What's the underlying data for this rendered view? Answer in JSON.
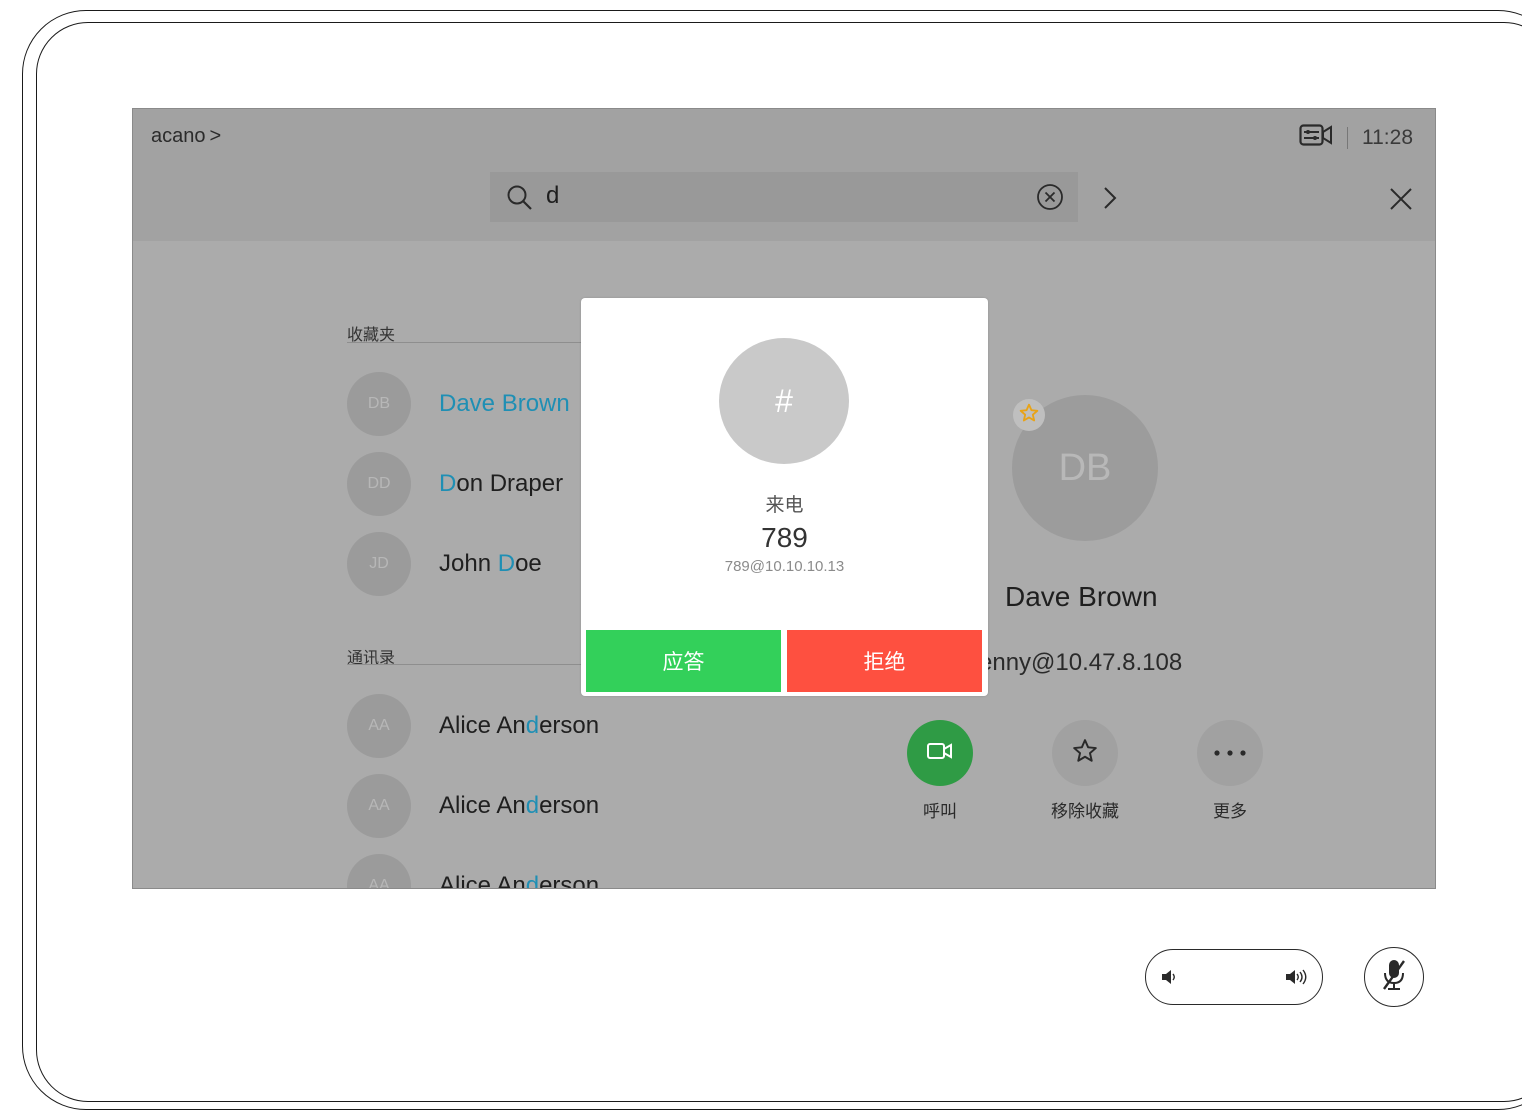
{
  "header": {
    "breadcrumb": "acano",
    "breadcrumb_chevron": ">",
    "time": "11:28"
  },
  "search": {
    "query": "d"
  },
  "favorites": {
    "label": "收藏夹",
    "items": [
      {
        "initials": "DB",
        "pre": "",
        "hl": "Dave Brown",
        "post": ""
      },
      {
        "initials": "DD",
        "pre": "",
        "hl": "D",
        "post": "on Draper"
      },
      {
        "initials": "JD",
        "pre": "John ",
        "hl": "D",
        "post": "oe"
      }
    ]
  },
  "contacts": {
    "label": "通讯录",
    "items": [
      {
        "initials": "AA",
        "pre": "Alice An",
        "hl": "d",
        "post": "erson"
      },
      {
        "initials": "AA",
        "pre": "Alice An",
        "hl": "d",
        "post": "erson"
      },
      {
        "initials": "AA",
        "pre": "Alice An",
        "hl": "d",
        "post": "erson"
      }
    ]
  },
  "detail": {
    "initials": "DB",
    "name": "Dave Brown",
    "uri": "enny@10.47.8.108",
    "actions": {
      "call": "呼叫",
      "unfavorite": "移除收藏",
      "more": "更多"
    }
  },
  "incoming": {
    "avatar": "#",
    "type": "来电",
    "number": "789",
    "uri": "789@10.10.10.13",
    "accept": "应答",
    "decline": "拒绝"
  },
  "colors": {
    "accept": "#33d05a",
    "decline": "#fe5040",
    "highlight": "#1f8fb4",
    "call_button": "#2f9b45",
    "star": "#e8a317"
  }
}
